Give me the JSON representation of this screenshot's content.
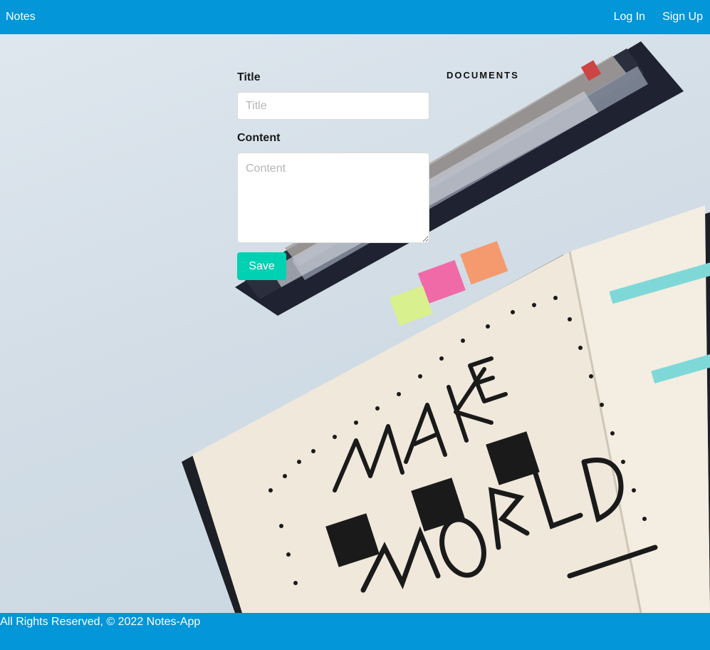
{
  "navbar": {
    "brand": "Notes",
    "login": "Log In",
    "signup": "Sign Up"
  },
  "form": {
    "title_label": "Title",
    "title_placeholder": "Title",
    "title_value": "",
    "content_label": "Content",
    "content_placeholder": "Content",
    "content_value": "",
    "save_label": "Save"
  },
  "documents": {
    "heading": "DOCUMENTS"
  },
  "footer": {
    "text": "All Rights Reserved, © 2022 Notes-App"
  },
  "colors": {
    "navbar": "#0396d8",
    "footer": "#0396d8",
    "save_button": "#00d1b2"
  }
}
